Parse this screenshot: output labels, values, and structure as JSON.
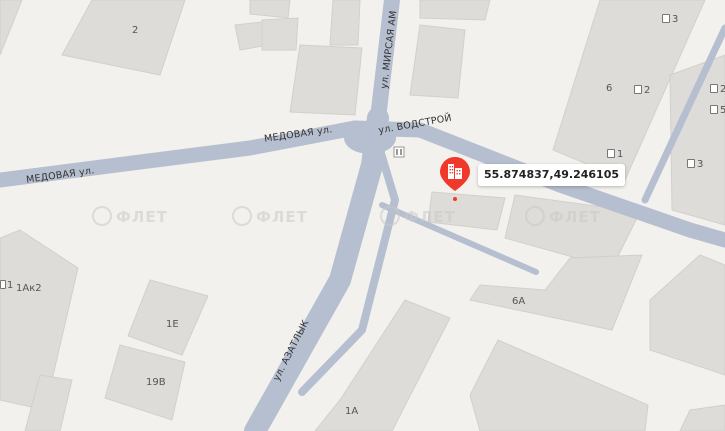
{
  "map": {
    "coordinates_label": "55.874837,49.246105",
    "marker_icon": "building-pin-icon",
    "accent_color": "#f0392b",
    "watermark": "ФЛЕТ",
    "streets": [
      {
        "id": "medovaya-west",
        "label": "МЕДОВАЯ ул."
      },
      {
        "id": "medovaya-east",
        "label": "МЕДОВАЯ ул."
      },
      {
        "id": "vodstroy",
        "label": "ул. ВОДСТРОЙ"
      },
      {
        "id": "mirsaya",
        "label": "ул. МИРСАЯ АМ"
      },
      {
        "id": "azatlyk",
        "label": "ул. АЗАТЛЫК"
      }
    ],
    "buildings": [
      {
        "id": "b-2",
        "label": "2"
      },
      {
        "id": "b-6",
        "label": "6"
      },
      {
        "id": "b-1ak2",
        "label": "1Ак2"
      },
      {
        "id": "b-1e",
        "label": "1Е"
      },
      {
        "id": "b-19v",
        "label": "19В"
      },
      {
        "id": "b-6a",
        "label": "6А"
      },
      {
        "id": "b-1a",
        "label": "1А"
      }
    ],
    "entrances": [
      {
        "id": "e-3-top",
        "label": "3"
      },
      {
        "id": "e-2-top",
        "label": "2"
      },
      {
        "id": "e-2-right",
        "label": "2"
      },
      {
        "id": "e-5",
        "label": "5"
      },
      {
        "id": "e-1",
        "label": "1"
      },
      {
        "id": "e-3-mid",
        "label": "3"
      },
      {
        "id": "e-1-left",
        "label": "1"
      }
    ]
  }
}
